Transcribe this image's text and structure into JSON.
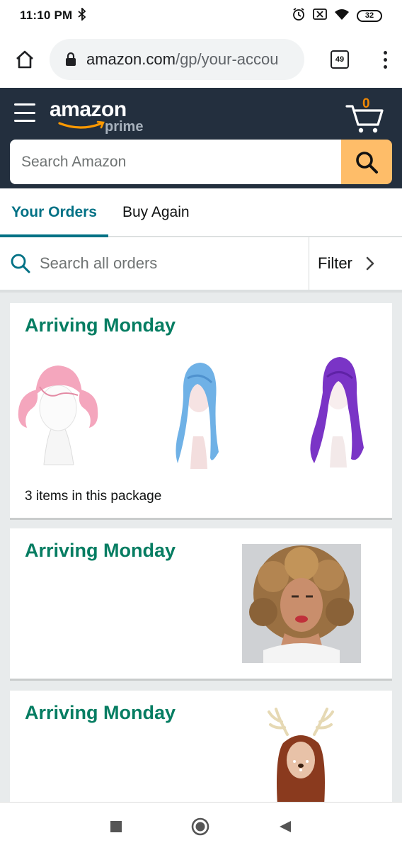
{
  "status_bar": {
    "time": "11:10 PM",
    "battery": "32"
  },
  "browser": {
    "url_host": "amazon.com",
    "url_path": "/gp/your-accou",
    "tab_count": "49"
  },
  "header": {
    "logo_text": "amazon",
    "logo_sub": "prime",
    "cart_count": "0",
    "search_placeholder": "Search Amazon"
  },
  "tabs": [
    {
      "label": "Your Orders",
      "active": true
    },
    {
      "label": "Buy Again",
      "active": false
    }
  ],
  "order_search": {
    "placeholder": "Search all orders",
    "filter_label": "Filter"
  },
  "orders": [
    {
      "status": "Arriving Monday",
      "item_count_text": "3 items in this package",
      "items": [
        "pink-pigtail-wig",
        "blue-long-wig",
        "purple-wavy-wig"
      ]
    },
    {
      "status": "Arriving Monday",
      "items": [
        "curly-blonde-afro-wig"
      ]
    },
    {
      "status": "Arriving Monday",
      "items": [
        "deer-antler-headband"
      ]
    }
  ],
  "colors": {
    "header_bg": "#232f3e",
    "search_button": "#febd69",
    "link_teal": "#007185",
    "status_green": "#067d62",
    "cart_orange": "#f08804"
  }
}
